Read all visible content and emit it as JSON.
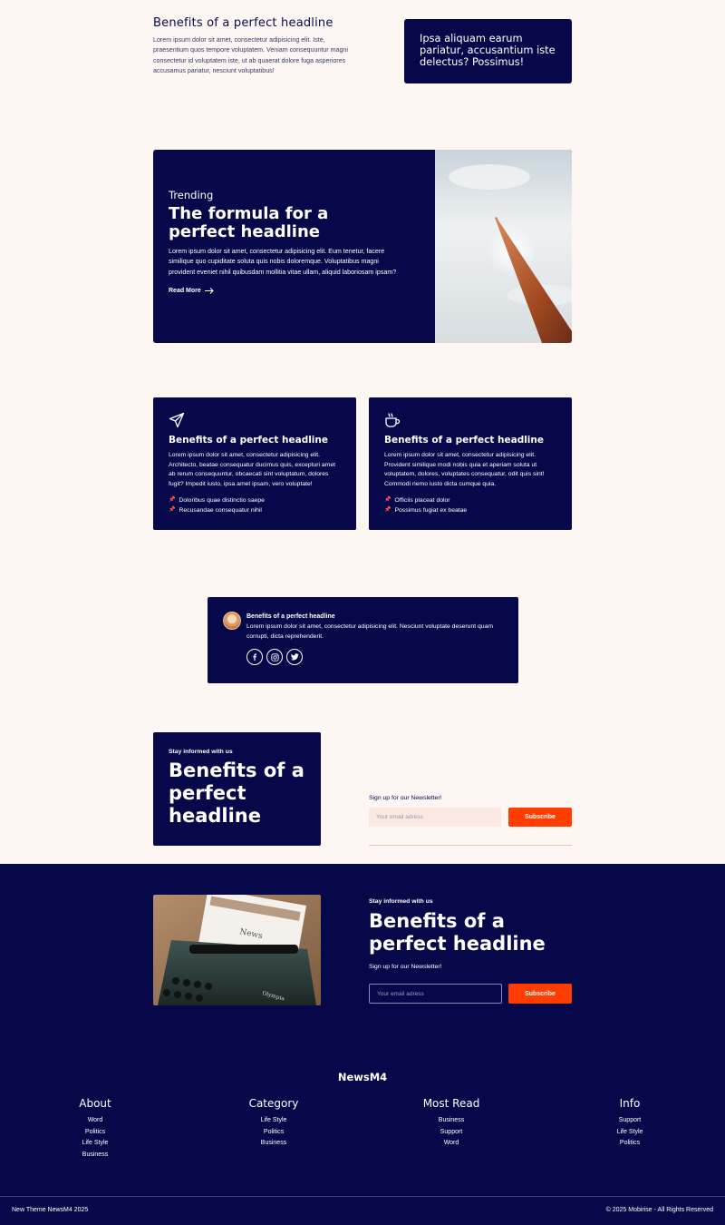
{
  "section1": {
    "title": "Benefits of a perfect headline",
    "text": "Lorem ipsum dolor sit amet, consectetur adipisicing elit. Iste, praesentium quos tempore voluptatem. Veniam consequuntur magni consectetur id voluptatem iste, ut ab quaerat dolore fuga asperiores accusamus pariatur, nesciunt voluptatibus!",
    "box_text": "Ipsa aliquam earum pariatur, accusantium iste delectus? Possimus!"
  },
  "hero": {
    "kicker": "Trending",
    "title": "The formula for a perfect headline",
    "text": "Lorem ipsum dolor sit amet, consectetur adipisicing elit. Eum tenetur, facere similique quo cupiditate soluta quis nobis doloremque. Voluptatibus magni provident eveniet nihil quibusdam mollitia vitae ullam, aliquid laboriosam ipsam?",
    "link": "Read More"
  },
  "cards": [
    {
      "icon": "paper-plane-icon",
      "title": "Benefits of a perfect headline",
      "text": "Lorem ipsum dolor sit amet, consectetur adipisicing elit. Architecto, beatae consequatur ducimus quis, excepturi amet ab rerum consequuntur, obcaecati sint voluptatum, dolores fugit? Impedit iusto, ipsa amet ipsam, vero voluptate!",
      "items": [
        "Doloribus quae distinctio saepe",
        "Recusandae consequatur nihil"
      ]
    },
    {
      "icon": "coffee-cup-icon",
      "title": "Benefits of a perfect headline",
      "text": "Lorem ipsum dolor sit amet, consectetur adipisicing elit. Provident similique modi nobis quia et aperiam soluta ut voluptatem, dolores, voluptates consequatur, odit quis sint! Commodi nemo iusto dicta cumque quia.",
      "items": [
        "Officiis placeat dolor",
        "Possimus fugiat ex beatae"
      ]
    }
  ],
  "testimonial": {
    "name": "Benefits of a perfect headline",
    "quote": "Lorem ipsum dolor sit amet, consectetur adipisicing elit. Nesciunt voluptate deserunt quam corrupti, dicta reprehenderit.",
    "socials": [
      "facebook-icon",
      "instagram-icon",
      "twitter-icon"
    ]
  },
  "newsletter": {
    "kicker": "Stay informed with us",
    "title": "Benefits of a perfect headline",
    "label": "Sign up for our Newsletter!",
    "placeholder": "Your email adress",
    "button": "Subscribe"
  },
  "newsletter_dark": {
    "kicker": "Stay informed with us",
    "title": "Benefits of a perfect headline",
    "label": "Sign up for our Newsletter!",
    "placeholder": "Your email adress",
    "button": "Subscribe"
  },
  "footer": {
    "brand": "NewsM4",
    "columns": [
      {
        "title": "About",
        "links": [
          "Word",
          "Politics",
          "Life Style",
          "Business"
        ]
      },
      {
        "title": "Category",
        "links": [
          "Life Style",
          "Politics",
          "Business"
        ]
      },
      {
        "title": "Most Read",
        "links": [
          "Business",
          "Support",
          "Word"
        ]
      },
      {
        "title": "Info",
        "links": [
          "Support",
          "Life Style",
          "Politics"
        ]
      }
    ],
    "left": "New Theme NewsM4 2025",
    "right": "© 2025 Mobirise - All Rights Reserved"
  },
  "colors": {
    "navy": "#070849",
    "accent": "#ff3d00",
    "background": "#fdf6f3"
  }
}
